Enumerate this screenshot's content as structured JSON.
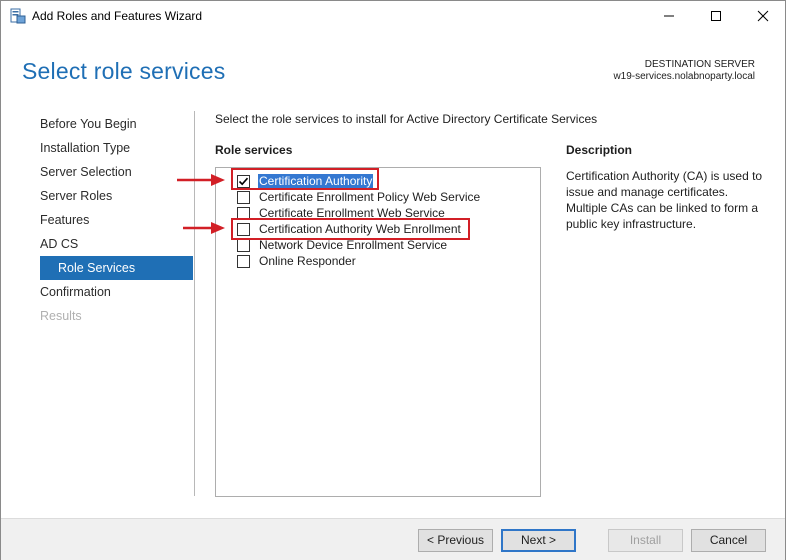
{
  "window": {
    "title": "Add Roles and Features Wizard"
  },
  "header": {
    "page_title": "Select role services",
    "destination_label": "DESTINATION SERVER",
    "destination_host": "w19-services.nolabnoparty.local"
  },
  "nav": {
    "items": [
      {
        "label": "Before You Begin",
        "state": "normal"
      },
      {
        "label": "Installation Type",
        "state": "normal"
      },
      {
        "label": "Server Selection",
        "state": "normal"
      },
      {
        "label": "Server Roles",
        "state": "normal"
      },
      {
        "label": "Features",
        "state": "normal"
      },
      {
        "label": "AD CS",
        "state": "normal"
      },
      {
        "label": "Role Services",
        "state": "active"
      },
      {
        "label": "Confirmation",
        "state": "normal"
      },
      {
        "label": "Results",
        "state": "disabled"
      }
    ]
  },
  "main": {
    "instruction": "Select the role services to install for Active Directory Certificate Services",
    "role_services_header": "Role services",
    "role_services": [
      {
        "label": "Certification Authority",
        "checked": true,
        "selected": true,
        "highlighted": true
      },
      {
        "label": "Certificate Enrollment Policy Web Service",
        "checked": false
      },
      {
        "label": "Certificate Enrollment Web Service",
        "checked": false
      },
      {
        "label": "Certification Authority Web Enrollment",
        "checked": false,
        "highlighted": true
      },
      {
        "label": "Network Device Enrollment Service",
        "checked": false
      },
      {
        "label": "Online Responder",
        "checked": false
      }
    ],
    "description_header": "Description",
    "description_text": "Certification Authority (CA) is used to issue and manage certificates. Multiple CAs can be linked to form a public key infrastructure."
  },
  "footer": {
    "previous_label": "< Previous",
    "next_label": "Next >",
    "install_label": "Install",
    "cancel_label": "Cancel"
  },
  "colors": {
    "accent": "#1f6fb5",
    "selection": "#3478d1",
    "annotation_red": "#d21f26"
  }
}
